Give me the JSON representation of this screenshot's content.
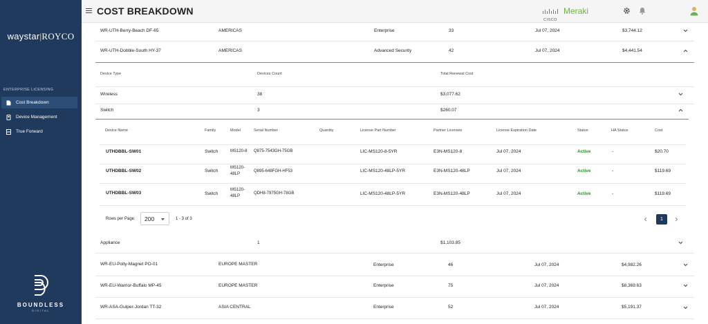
{
  "sidebar": {
    "brand_left": "waystar",
    "brand_right": "ROYCO",
    "section_label": "ENTERPRISE LICENSING",
    "items": [
      {
        "label": "Cost Breakdown"
      },
      {
        "label": "Device Management"
      },
      {
        "label": "True Forward"
      }
    ],
    "footer_title": "BOUNDLESS",
    "footer_sub": "DIGITAL"
  },
  "header": {
    "title": "COST BREAKDOWN",
    "cisco": "CISCO",
    "meraki": "Meraki"
  },
  "top_rows": [
    {
      "name": "WR-UTH-Berry-Beach DF-65",
      "region": "AMERICAS",
      "license": "Enterprise",
      "count": "33",
      "date": "Jul 07, 2024",
      "cost": "$3,744.12"
    },
    {
      "name": "WR-UTH-Dobble-South HY-37",
      "region": "AMERICAS",
      "license": "Advanced Security",
      "count": "42",
      "date": "Jul 07, 2024",
      "cost": "$4,441.54"
    }
  ],
  "device_type_headers": {
    "type": "Device Type",
    "count": "Devices Count",
    "cost": "Total Renewal Cost"
  },
  "device_types": [
    {
      "type": "Wireless",
      "count": "38",
      "cost": "$3,077.62"
    },
    {
      "type": "Switch",
      "count": "3",
      "cost": "$260.07"
    },
    {
      "type": "Appliance",
      "count": "1",
      "cost": "$1,103.85"
    }
  ],
  "device_headers": {
    "name": "Device Name",
    "family": "Family",
    "model": "Model",
    "serial": "Serial Number",
    "quantity": "Quantity",
    "license_pn": "License Part Number",
    "partner": "Partner Licenses",
    "expiration": "License Expiration Date",
    "status": "Status",
    "ha": "HA Status",
    "cost": "Cost"
  },
  "devices": [
    {
      "name": "UTHDBBL-SW01",
      "family": "Switch",
      "model1": "MS120-8",
      "model2": "",
      "serial": "Q875-7543GH-75GB",
      "license_pn": "LIC-MS120-8-5YR",
      "partner": "E3N-MS120-8",
      "expiration": "Jul 07, 2024",
      "status": "Active",
      "ha": "-",
      "cost": "$20.70"
    },
    {
      "name": "UTHDBBL-SW02",
      "family": "Switch",
      "model1": "MS120-",
      "model2": "48LP",
      "serial": "Q895-648FGH-HF53",
      "license_pn": "LIC-MS120-48LP-5YR",
      "partner": "E3N-MS120-48LP",
      "expiration": "Jul 07, 2024",
      "status": "Active",
      "ha": "-",
      "cost": "$119.69"
    },
    {
      "name": "UTHDBBL-SW03",
      "family": "Switch",
      "model1": "MS120-",
      "model2": "48LP",
      "serial": "QDH8-7975GH-78GB",
      "license_pn": "LIC-MS120-48LP-5YR",
      "partner": "E3N-MS120-48LP",
      "expiration": "Jul 07, 2024",
      "status": "Active",
      "ha": "-",
      "cost": "$119.69"
    }
  ],
  "pagination": {
    "rows_label": "Rows per Page:",
    "rows_value": "200",
    "range": "1 - 3 of 3",
    "page": "1"
  },
  "bottom_rows": [
    {
      "name": "WR-EU-Polty-Magnet PO-01",
      "region": "EUROPE MASTER",
      "license": "Enterprise",
      "count": "46",
      "date": "Jul 07, 2024",
      "cost": "$4,982.26"
    },
    {
      "name": "WR-EU-Warrior-Buffalo MP-45",
      "region": "EUROPE MASTER",
      "license": "Enterprise",
      "count": "75",
      "date": "Jul 07, 2024",
      "cost": "$8,369.63"
    },
    {
      "name": "WR-ASA-Gulper-Jordan TT-32",
      "region": "ASIA CENTRAL",
      "license": "Enterprise",
      "count": "52",
      "date": "Jul 07, 2024",
      "cost": "$5,191.37"
    }
  ]
}
